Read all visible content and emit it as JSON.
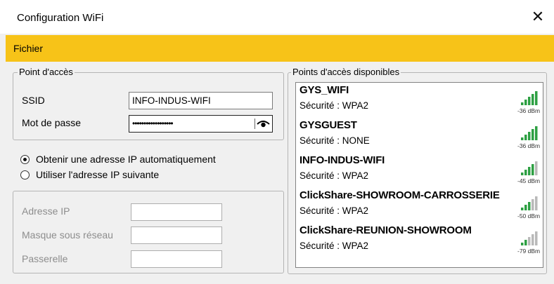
{
  "window": {
    "title": "Configuration WiFi",
    "close_glyph": "✕"
  },
  "menu": {
    "items": [
      "Fichier"
    ]
  },
  "access_point": {
    "legend": "Point d'accès",
    "ssid_label": "SSID",
    "ssid_value": "INFO-INDUS-WIFI",
    "password_label": "Mot de passe",
    "password_value": "••••••••••••••••••",
    "eye_icon": "eye-icon"
  },
  "ip_mode": {
    "auto_label": "Obtenir une adresse IP automatiquement",
    "auto_checked": true,
    "manual_label": "Utiliser l'adresse IP suivante",
    "manual_checked": false
  },
  "ip_fields": {
    "address_label": "Adresse IP",
    "mask_label": "Masque  sous réseau",
    "gateway_label": "Passerelle",
    "address_value": "",
    "mask_value": "",
    "gateway_value": ""
  },
  "available": {
    "legend": "Points d'accès disponibles",
    "items": [
      {
        "name": "GYS_WIFI",
        "security": "Sécurité : WPA2",
        "dbm": "-36 dBm",
        "bars": 5,
        "color": "#2ea043"
      },
      {
        "name": "GYSGUEST",
        "security": "Sécurité : NONE",
        "dbm": "-36 dBm",
        "bars": 5,
        "color": "#2ea043"
      },
      {
        "name": "INFO-INDUS-WIFI",
        "security": "Sécurité : WPA2",
        "dbm": "-45 dBm",
        "bars": 4,
        "color": "#2ea043"
      },
      {
        "name": "ClickShare-SHOWROOM-CARROSSERIE",
        "security": "Sécurité : WPA2",
        "dbm": "-50 dBm",
        "bars": 3,
        "color": "#2ea043"
      },
      {
        "name": "ClickShare-REUNION-SHOWROOM",
        "security": "Sécurité : WPA2",
        "dbm": "-79 dBm",
        "bars": 2,
        "color": "#2ea043"
      }
    ]
  }
}
